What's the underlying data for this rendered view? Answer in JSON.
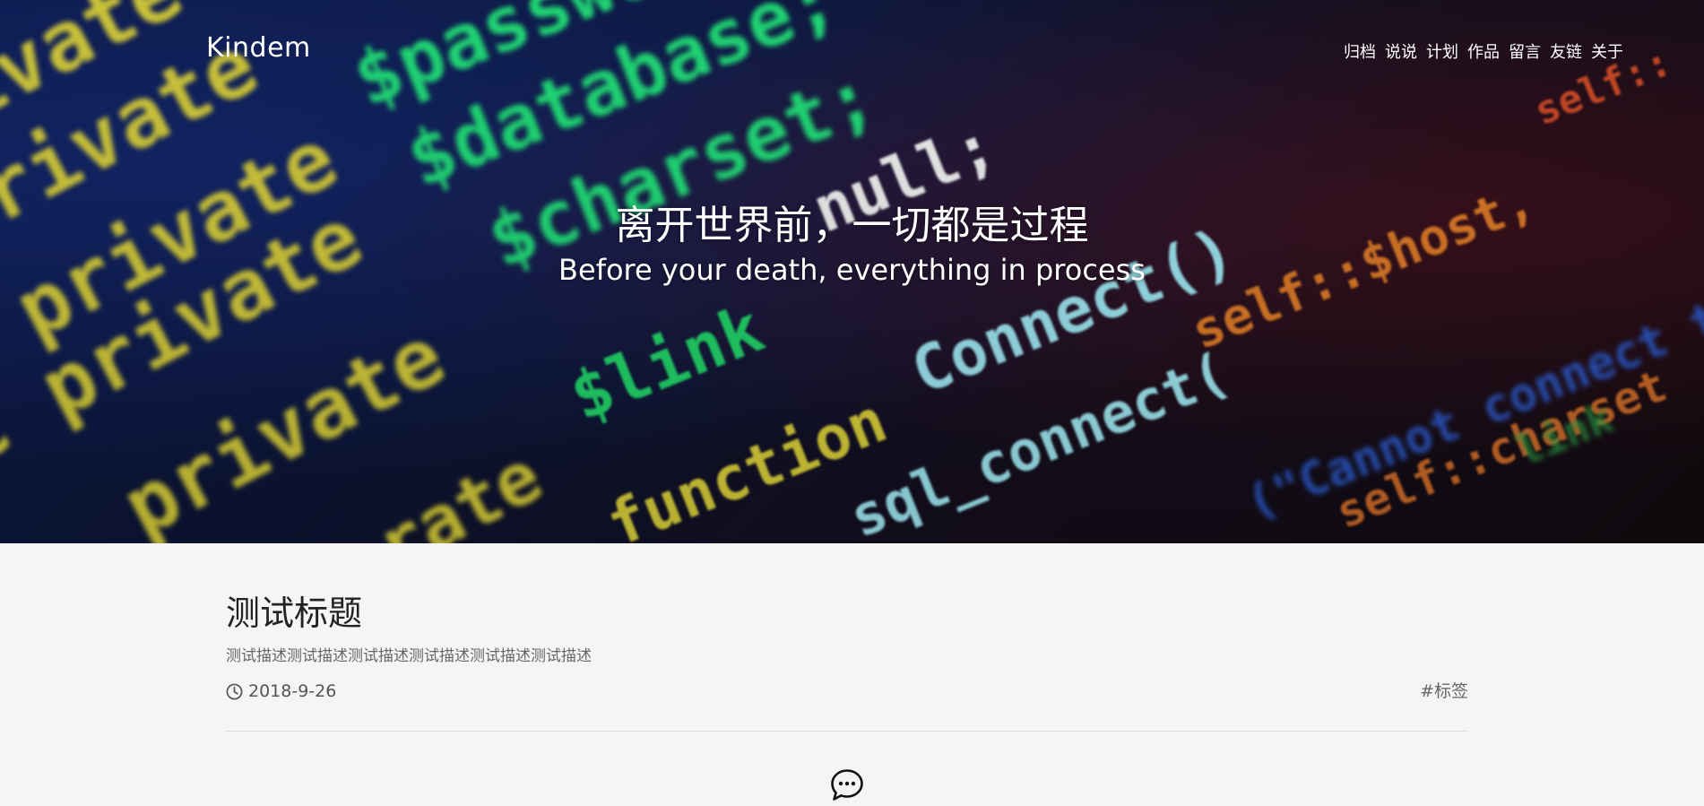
{
  "header": {
    "brand": "Kindem",
    "nav": [
      {
        "label": "归档"
      },
      {
        "label": "说说"
      },
      {
        "label": "计划"
      },
      {
        "label": "作品"
      },
      {
        "label": "留言"
      },
      {
        "label": "友链"
      },
      {
        "label": "关于"
      }
    ]
  },
  "hero": {
    "title": "离开世界前，一切都是过程",
    "subtitle": "Before your death, everything in process"
  },
  "post": {
    "title": "测试标题",
    "description": "测试描述测试描述测试描述测试描述测试描述测试描述",
    "date": "2018-9-26",
    "tag": "#标签"
  },
  "icons": {
    "date": "clock-icon",
    "comments": "comment-icon"
  }
}
